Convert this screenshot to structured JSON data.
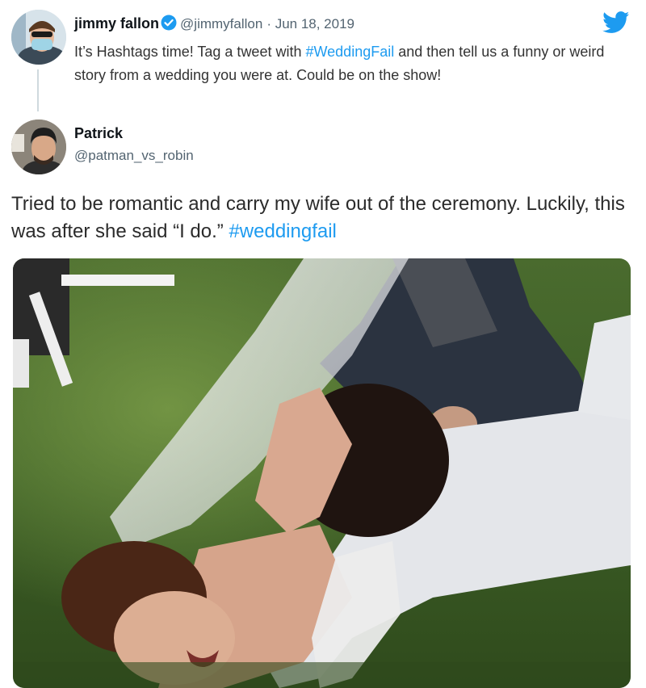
{
  "original_tweet": {
    "author_name": "jimmy fallon",
    "author_handle": "@jimmyfallon",
    "date": "· Jun 18, 2019",
    "text_before": "It’s Hashtags time! Tag a tweet with ",
    "hashtag": "#WeddingFail",
    "text_after": " and then tell us a funny or weird story from a wedding you were at. Could be on the show!",
    "verified_icon": "verified-badge-icon",
    "brand_icon": "twitter-bird-icon"
  },
  "reply_tweet": {
    "author_name": "Patrick",
    "author_handle": "@patman_vs_robin",
    "text": "Tried to be romantic and carry my wife out of the ceremony. Luckily, this was after she said “I do.” ",
    "hashtag": "#weddingfail"
  },
  "colors": {
    "accent": "#1d9bf0",
    "secondary_text": "#536471"
  }
}
